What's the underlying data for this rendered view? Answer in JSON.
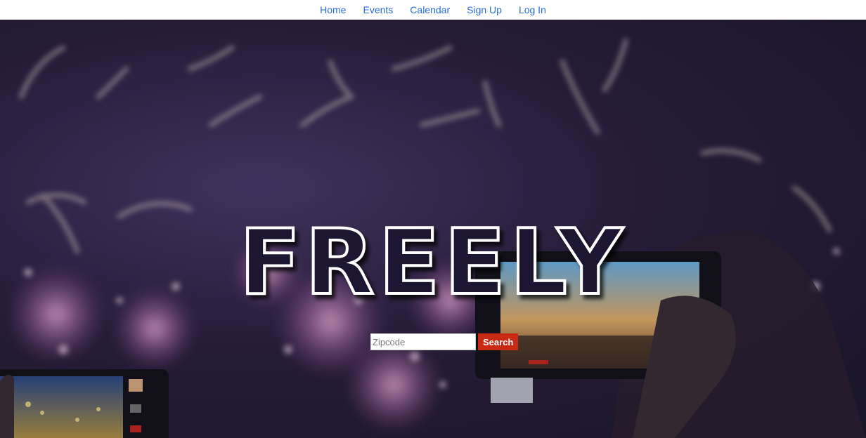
{
  "nav": {
    "items": [
      {
        "label": "Home"
      },
      {
        "label": "Events"
      },
      {
        "label": "Calendar"
      },
      {
        "label": "Sign Up"
      },
      {
        "label": "Log In"
      }
    ]
  },
  "hero": {
    "title": "FREELY",
    "background": "fireworks-crowd-photo"
  },
  "search": {
    "placeholder": "Zipcode",
    "value": "",
    "button_label": "Search"
  },
  "colors": {
    "link": "#2a6ed6",
    "button": "#c92a16",
    "hero_dark": "#1f1a30"
  }
}
